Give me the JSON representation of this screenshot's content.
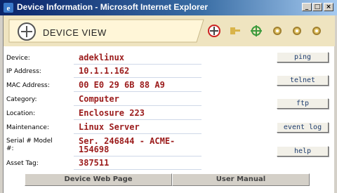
{
  "window": {
    "title": "Device Information - Microsoft Internet Explorer"
  },
  "header": {
    "label": "DEVICE VIEW"
  },
  "fields": [
    {
      "label": "Device:",
      "value": "adeklinux"
    },
    {
      "label": "IP Address:",
      "value": "10.1.1.162"
    },
    {
      "label": "MAC Address:",
      "value": "00 E0 29 6B 88 A9"
    },
    {
      "label": "Category:",
      "value": "Computer"
    },
    {
      "label": "Location:",
      "value": "Enclosure 223"
    },
    {
      "label": "Maintenance:",
      "value": "Linux Server"
    },
    {
      "label_line1": "Serial # Model",
      "label_line2": "#:",
      "value_line1": "Ser. 246844 - ACME-",
      "value_line2": "154698"
    },
    {
      "label": "Asset Tag:",
      "value": "387511"
    }
  ],
  "actions": [
    "ping",
    "telnet",
    "ftp",
    "event log",
    "help"
  ],
  "bottom_buttons": [
    "Device Web Page",
    "User Manual"
  ],
  "colors": {
    "value_text": "#9b1b1b",
    "header_bg": "#efe4c0",
    "title_bar": "#0a246a"
  },
  "icons": [
    "ie-icon",
    "minimize-icon",
    "maximize-icon",
    "close-icon",
    "device-view-logo-icon",
    "home-icon",
    "key-icon",
    "network-icon",
    "settings-icon",
    "gear-icon",
    "tools-icon"
  ]
}
